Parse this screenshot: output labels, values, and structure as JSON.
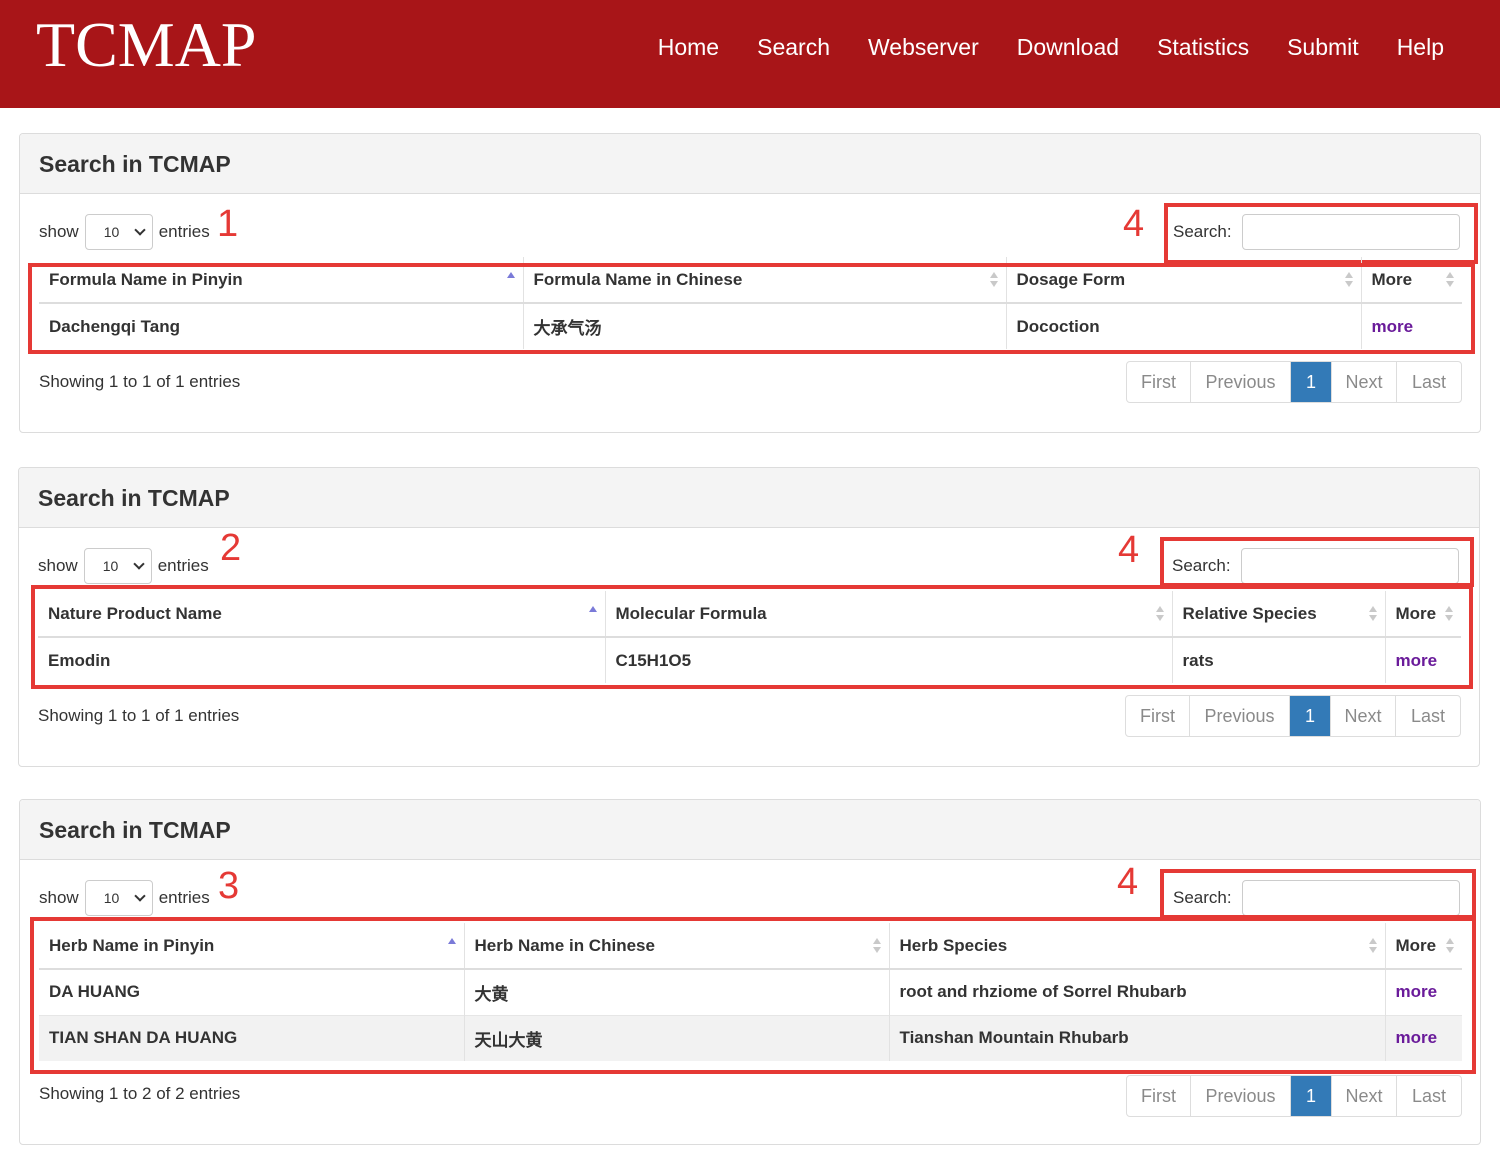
{
  "header": {
    "brand": "TCMAP",
    "nav": [
      "Home",
      "Search",
      "Webserver",
      "Download",
      "Statistics",
      "Submit",
      "Help"
    ]
  },
  "panels": [
    {
      "title": "Search in TCMAP",
      "length": {
        "show": "show",
        "value": "10",
        "entries": "entries"
      },
      "marker": "1",
      "search_marker": "4",
      "search_label": "Search:",
      "columns": [
        "Formula Name in Pinyin",
        "Formula Name in Chinese",
        "Dosage Form",
        "More"
      ],
      "rows": [
        [
          "Dachengqi Tang",
          "大承气汤",
          "Docoction",
          "more"
        ]
      ],
      "info": "Showing 1 to 1 of 1 entries",
      "pager": [
        "First",
        "Previous",
        "1",
        "Next",
        "Last"
      ]
    },
    {
      "title": "Search in TCMAP",
      "length": {
        "show": "show",
        "value": "10",
        "entries": "entries"
      },
      "marker": "2",
      "search_marker": "4",
      "search_label": "Search:",
      "columns": [
        "Nature Product Name",
        "Molecular Formula",
        "Relative Species",
        "More"
      ],
      "rows": [
        [
          "Emodin",
          "C15H1O5",
          "rats",
          "more"
        ]
      ],
      "info": "Showing 1 to 1 of 1 entries",
      "pager": [
        "First",
        "Previous",
        "1",
        "Next",
        "Last"
      ]
    },
    {
      "title": "Search in TCMAP",
      "length": {
        "show": "show",
        "value": "10",
        "entries": "entries"
      },
      "marker": "3",
      "search_marker": "4",
      "search_label": "Search:",
      "columns": [
        "Herb Name in Pinyin",
        "Herb Name in Chinese",
        "Herb Species",
        "More"
      ],
      "rows": [
        [
          "DA HUANG",
          "大黄",
          "root and rhziome of Sorrel Rhubarb",
          "more"
        ],
        [
          "TIAN SHAN DA HUANG",
          "天山大黄",
          "Tianshan Mountain Rhubarb",
          "more"
        ]
      ],
      "info": "Showing 1 to 2 of 2 entries",
      "pager": [
        "First",
        "Previous",
        "1",
        "Next",
        "Last"
      ]
    }
  ]
}
